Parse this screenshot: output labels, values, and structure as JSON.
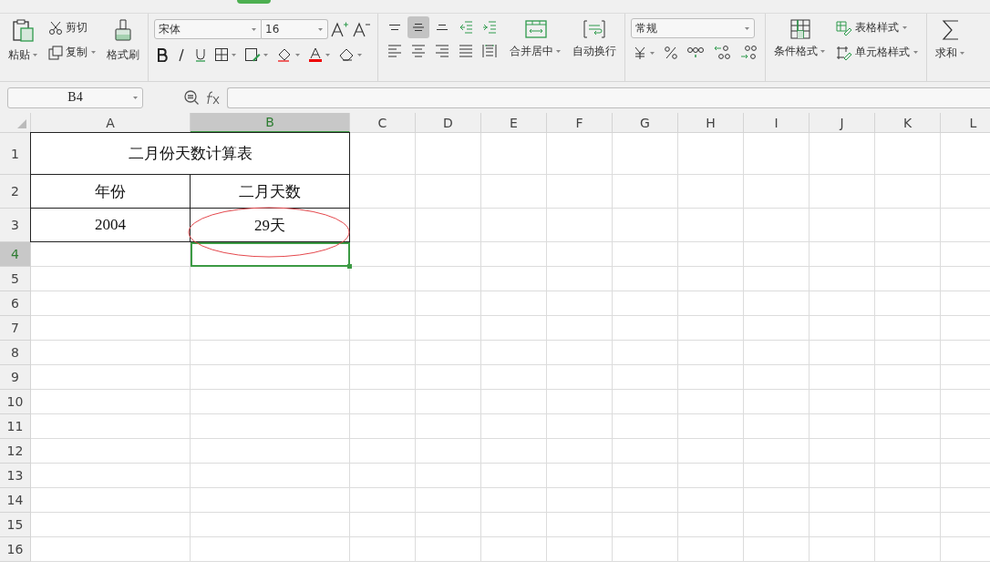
{
  "toolbar": {
    "paste": "粘贴",
    "cut": "剪切",
    "copy": "复制",
    "format_painter": "格式刷",
    "font_name": "宋体",
    "font_size": "16",
    "alignment": [
      {
        "kind": "top",
        "selected": false
      },
      {
        "kind": "middle",
        "selected": true
      },
      {
        "kind": "bottom",
        "selected": false
      },
      {
        "kind": "outdent",
        "selected": false
      },
      {
        "kind": "indent",
        "selected": false
      },
      {
        "kind": "left",
        "selected": false
      },
      {
        "kind": "center",
        "selected": false
      },
      {
        "kind": "right",
        "selected": false
      },
      {
        "kind": "justify",
        "selected": false
      },
      {
        "kind": "distributed",
        "selected": false
      }
    ],
    "merge": "合并居中",
    "wrap": "自动换行",
    "number_format": "常规",
    "conditional_format": "条件格式",
    "table_style": "表格样式",
    "cell_style": "单元格样式",
    "sum": "求和"
  },
  "formula_bar": {
    "name_box": "B4"
  },
  "sheet": {
    "columns": [
      {
        "label": "A",
        "selected": false
      },
      {
        "label": "B",
        "selected": true
      },
      {
        "label": "C",
        "selected": false
      },
      {
        "label": "D",
        "selected": false
      },
      {
        "label": "E",
        "selected": false
      },
      {
        "label": "F",
        "selected": false
      },
      {
        "label": "G",
        "selected": false
      },
      {
        "label": "H",
        "selected": false
      },
      {
        "label": "I",
        "selected": false
      },
      {
        "label": "J",
        "selected": false
      },
      {
        "label": "K",
        "selected": false
      },
      {
        "label": "L",
        "selected": false
      }
    ],
    "rows": [
      {
        "label": "1",
        "selected": false,
        "cells": [
          {
            "text": "二月份天数计算表",
            "merged": true,
            "boxed": true,
            "selected": false
          }
        ]
      },
      {
        "label": "2",
        "selected": false,
        "cells": [
          {
            "text": "年份",
            "boxed": true,
            "selected": false
          },
          {
            "text": "二月天数",
            "boxed": true,
            "selected": false
          }
        ]
      },
      {
        "label": "3",
        "selected": false,
        "cells": [
          {
            "text": "2004",
            "boxed": true,
            "selected": false
          },
          {
            "text": "29天",
            "boxed": true,
            "selected": false,
            "circled": true
          }
        ]
      },
      {
        "label": "4",
        "selected": true,
        "cells": [
          {
            "boxed": false,
            "selected": false
          },
          {
            "boxed": false,
            "selected": true
          }
        ]
      },
      {
        "label": "5",
        "selected": false
      },
      {
        "label": "6",
        "selected": false
      },
      {
        "label": "7",
        "selected": false
      },
      {
        "label": "8",
        "selected": false
      },
      {
        "label": "9",
        "selected": false
      },
      {
        "label": "10",
        "selected": false
      },
      {
        "label": "11",
        "selected": false
      },
      {
        "label": "12",
        "selected": false
      },
      {
        "label": "13",
        "selected": false
      },
      {
        "label": "14",
        "selected": false
      },
      {
        "label": "15",
        "selected": false
      },
      {
        "label": "16",
        "selected": false
      }
    ]
  }
}
